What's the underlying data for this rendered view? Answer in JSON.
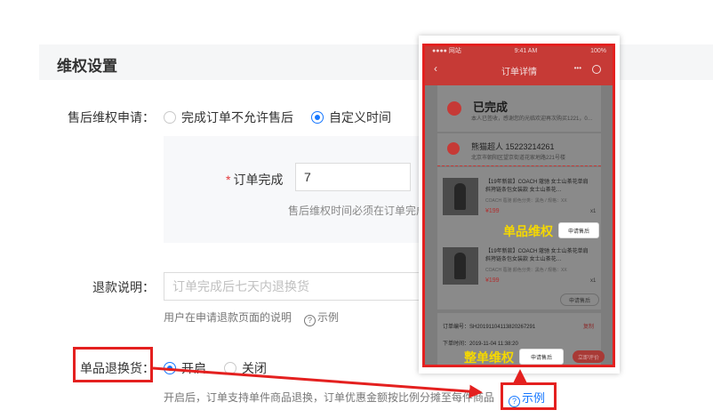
{
  "section": {
    "title": "维权设置"
  },
  "after_sale": {
    "label": "售后维权申请：",
    "options": [
      "完成订单不允许售后",
      "自定义时间"
    ],
    "selected": "自定义时间",
    "order_complete_label": "订单完成",
    "days_value": "7",
    "hint": "售后维权时间必须在订单完成"
  },
  "refund": {
    "label": "退款说明：",
    "placeholder": "订单完成后七天内退换货",
    "hint": "用户在申请退款页面的说明",
    "example_label": "示例"
  },
  "single_return": {
    "label": "单品退换货：",
    "options": [
      "开启",
      "关闭"
    ],
    "selected": "开启",
    "hint": "开启后，订单支持单件商品退换，订单优惠金额按比例分摊至每件商品",
    "example_label": "示例"
  },
  "preview": {
    "status_bar": {
      "carrier": "●●●● 网站",
      "time": "9:41 AM",
      "battery": "100%"
    },
    "nav_title": "订单详情",
    "nav_capsule": "•••",
    "order_status": "已完成",
    "order_status_sub": "本人已签收，感谢您的光临欢迎再次购买1221，0…",
    "receiver": "熊猫超人   15223214261",
    "address": "北京市朝阳区望京街道花家地路221号楼",
    "items": [
      {
        "name": "【19年新款】COACH 蔻驰 女士山茶花单肩斜挎链条包女装款 女士山茶花…",
        "sku": "COACH 蔻驰 颜色分类：黑色 / 规格：XX",
        "price": "¥199",
        "qty": "x1",
        "button": "申请售后"
      },
      {
        "name": "【19年新款】COACH 蔻驰 女士山茶花单肩斜挎链条包女装款 女士山茶花…",
        "sku": "COACH 蔻驰 颜色分类：黑色 / 规格：XX",
        "price": "¥199",
        "qty": "x1",
        "button": "申请售后"
      }
    ],
    "order_no": "订单编号：SH20191104113820267291",
    "copy_label": "复制",
    "order_time": "下单时间：2019-11-04 11:38:20",
    "bottom_button_1": "申请售后",
    "bottom_button_2": "立即评价"
  },
  "annotations": {
    "single_item": "单品维权",
    "whole_order": "整单维权"
  },
  "colors": {
    "primary": "#1677ff",
    "highlight": "#e4201f",
    "annotation": "#f5d800",
    "theme_red": "#c63a36"
  }
}
